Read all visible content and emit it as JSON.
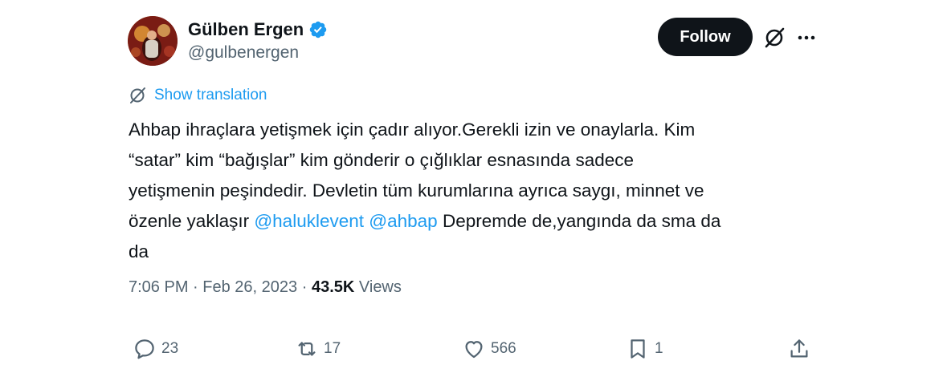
{
  "author": {
    "display_name": "Gülben Ergen",
    "handle": "@gulbenergen",
    "verified": true,
    "avatar_icon": "avatar-photo"
  },
  "header": {
    "follow_label": "Follow",
    "icons": [
      "grok-icon",
      "more-icon"
    ]
  },
  "translation": {
    "label": "Show translation",
    "icon": "globe-slash-icon"
  },
  "tweet": {
    "lines": [
      [
        {
          "text": "Ahbap ihraçlara yetişmek için çadır alıyor.Gerekli izin ve onaylarla. Kim",
          "type": "text"
        }
      ],
      [
        {
          "text": "“satar” kim “bağışlar” kim gönderir o çığlıklar esnasında sadece",
          "type": "text"
        }
      ],
      [
        {
          "text": "yetişmenin peşindedir. Devletin tüm kurumlarına ayrıca saygı, minnet ve",
          "type": "text"
        }
      ],
      [
        {
          "text": "özenle yaklaşır ",
          "type": "text"
        },
        {
          "text": "@haluklevent",
          "type": "mention"
        },
        {
          "text": " ",
          "type": "text"
        },
        {
          "text": "@ahbap",
          "type": "mention"
        },
        {
          "text": " Depremde de,yangında da sma da",
          "type": "text"
        }
      ],
      [
        {
          "text": "da",
          "type": "text"
        }
      ]
    ]
  },
  "meta": {
    "time": "7:06 PM",
    "separator": "·",
    "date": "Feb 26, 2023",
    "views_count": "43.5K",
    "views_label": "Views"
  },
  "actions": {
    "replies": "23",
    "reposts": "17",
    "likes": "566",
    "bookmarks": "1"
  },
  "colors": {
    "accent": "#1d9bf0",
    "text": "#0f1419",
    "muted": "#536471",
    "follow_bg": "#0f1419"
  }
}
